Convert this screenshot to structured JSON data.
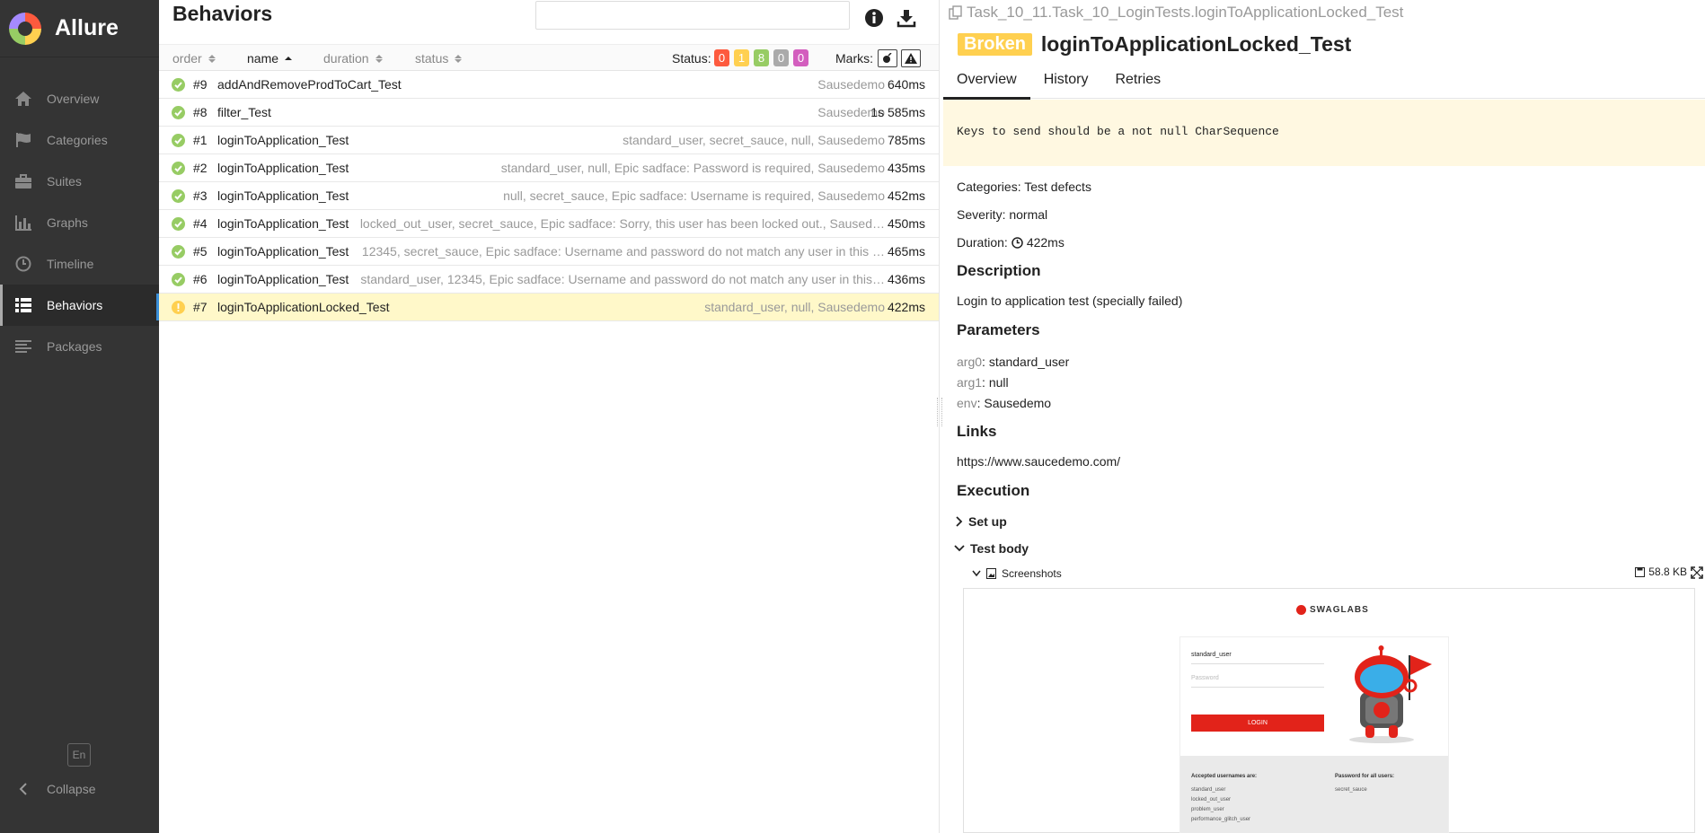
{
  "sidebar": {
    "brand": "Allure",
    "items": [
      {
        "label": "Overview",
        "icon": "home-icon"
      },
      {
        "label": "Categories",
        "icon": "flag-icon"
      },
      {
        "label": "Suites",
        "icon": "briefcase-icon"
      },
      {
        "label": "Graphs",
        "icon": "bar-chart-icon"
      },
      {
        "label": "Timeline",
        "icon": "clock-icon"
      },
      {
        "label": "Behaviors",
        "icon": "list-icon",
        "active": true
      },
      {
        "label": "Packages",
        "icon": "align-left-icon"
      }
    ],
    "language": "En",
    "collapse_label": "Collapse"
  },
  "middle": {
    "title": "Behaviors",
    "search_value": "",
    "sort": {
      "order": "order",
      "name": "name",
      "duration": "duration",
      "status": "status"
    },
    "status_label": "Status:",
    "status_counts": [
      {
        "value": "0",
        "color": "#fd5a3e"
      },
      {
        "value": "1",
        "color": "#ffd050"
      },
      {
        "value": "8",
        "color": "#97cc64"
      },
      {
        "value": "0",
        "color": "#aaaaaa"
      },
      {
        "value": "0",
        "color": "#d35ebe"
      }
    ],
    "marks_label": "Marks:",
    "rows": [
      {
        "order": "#9",
        "name": "addAndRemoveProdToCart_Test",
        "params": "Sausedemo",
        "duration": "640ms",
        "status": "passed"
      },
      {
        "order": "#8",
        "name": "filter_Test",
        "params": "Sausedemo",
        "duration": "1s 585ms",
        "status": "passed"
      },
      {
        "order": "#1",
        "name": "loginToApplication_Test",
        "params": "standard_user, secret_sauce, null, Sausedemo",
        "duration": "785ms",
        "status": "passed"
      },
      {
        "order": "#2",
        "name": "loginToApplication_Test",
        "params": "standard_user, null, Epic sadface: Password is required, Sausedemo",
        "duration": "435ms",
        "status": "passed"
      },
      {
        "order": "#3",
        "name": "loginToApplication_Test",
        "params": "null, secret_sauce, Epic sadface: Username is required, Sausedemo",
        "duration": "452ms",
        "status": "passed"
      },
      {
        "order": "#4",
        "name": "loginToApplication_Test",
        "params": "locked_out_user, secret_sauce, Epic sadface: Sorry, this user has been locked out., Saused…",
        "duration": "450ms",
        "status": "passed"
      },
      {
        "order": "#5",
        "name": "loginToApplication_Test",
        "params": "12345, secret_sauce, Epic sadface: Username and password do not match any user in this …",
        "duration": "465ms",
        "status": "passed"
      },
      {
        "order": "#6",
        "name": "loginToApplication_Test",
        "params": "standard_user, 12345, Epic sadface: Username and password do not match any user in this…",
        "duration": "436ms",
        "status": "passed"
      },
      {
        "order": "#7",
        "name": "loginToApplicationLocked_Test",
        "params": "standard_user, null, Sausedemo",
        "duration": "422ms",
        "status": "broken",
        "selected": true
      }
    ]
  },
  "right": {
    "path": "Task_10_11.Task_10_LoginTests.loginToApplicationLocked_Test",
    "status_badge": "Broken",
    "title": "loginToApplicationLocked_Test",
    "tabs": [
      "Overview",
      "History",
      "Retries"
    ],
    "error_message": "Keys to send should be a not null CharSequence",
    "categories_label": "Categories:",
    "categories_value": "Test defects",
    "severity_label": "Severity:",
    "severity_value": "normal",
    "duration_label": "Duration:",
    "duration_value": "422ms",
    "description_heading": "Description",
    "description_text": "Login to application test (specially failed)",
    "parameters_heading": "Parameters",
    "parameters": [
      {
        "key": "arg0",
        "value": "standard_user"
      },
      {
        "key": "arg1",
        "value": "null"
      },
      {
        "key": "env",
        "value": "Sausedemo"
      }
    ],
    "links_heading": "Links",
    "link": "https://www.saucedemo.com/",
    "execution_heading": "Execution",
    "setup_label": "Set up",
    "testbody_label": "Test body",
    "attachment_name": "Screenshots",
    "attachment_size": "58.8 KB"
  },
  "preview": {
    "logo": "SWAGLABS",
    "username_value": "standard_user",
    "password_placeholder": "Password",
    "login_button": "LOGIN",
    "usernames_heading": "Accepted usernames are:",
    "usernames": [
      "standard_user",
      "locked_out_user",
      "problem_user",
      "performance_glitch_user"
    ],
    "password_heading": "Password for all users:",
    "password_value": "secret_sauce"
  }
}
